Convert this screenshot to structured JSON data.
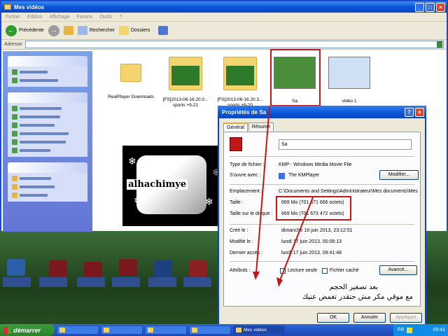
{
  "explorer": {
    "title": "Mes vidéos",
    "menu": [
      "Fichier",
      "Edition",
      "Affichage",
      "Favoris",
      "Outils",
      "?"
    ],
    "toolbar": {
      "back": "Précédente",
      "search": "Rechercher",
      "folders": "Dossiers"
    },
    "address_label": "Adresse",
    "files": [
      {
        "name": "RealPlayer Downloads",
        "kind": "folder"
      },
      {
        "name": "[FS]2013-06-16.20.0... sports +9-21",
        "kind": "folder-video"
      },
      {
        "name": "[FS]2013-06-16.20.3... sports +9-20",
        "kind": "folder-video"
      },
      {
        "name": "Sa",
        "kind": "video"
      },
      {
        "name": "vidéo 1",
        "kind": "video"
      }
    ],
    "logo_text": "alhachimye"
  },
  "dialog": {
    "title": "Propriétés de Sa",
    "tabs": [
      "Général",
      "Résumé"
    ],
    "name_value": "Sa",
    "rows": [
      {
        "label": "Type de fichier :",
        "value": "KMP - Windows Media Movie File"
      },
      {
        "label": "S'ouvre avec :",
        "value": "The KMPlayer"
      },
      {
        "label": "Emplacement :",
        "value": "C:\\Documents and Settings\\Administrateur\\Mes documents\\Mes vic"
      },
      {
        "label": "Taille :",
        "value": "669 Mo (701 671 666 octets)"
      },
      {
        "label": "Taille sur le disque :",
        "value": "669 Mo (701 673 472 octets)"
      },
      {
        "label": "Créé le :",
        "value": "dimanche 16 juin 2013, 23:12:51"
      },
      {
        "label": "Modifié le :",
        "value": "lundi 17 juin 2013, 00:06:13"
      },
      {
        "label": "Dernier accès :",
        "value": "lundi 17 juin 2013, 09:41:48"
      }
    ],
    "attributes_label": "Attributs :",
    "readonly_label": "Lecture seule",
    "hidden_label": "Fichier caché",
    "modify_button": "Modifier...",
    "advanced_button": "Avancé...",
    "ok_button": "OK",
    "cancel_button": "Annuler",
    "apply_button": "Appliquer"
  },
  "annotation": {
    "line1": "بعد تصغير الحجم",
    "line2": "مع موقي مكر مش حتقدر تغمض عنيك"
  },
  "taskbar": {
    "start_label": "démarrer",
    "active_task": "Mes vidéos",
    "lang": "FR",
    "time": "09:41"
  },
  "colors": {
    "annotation_red": "#c01818",
    "xp_blue": "#0b54d4",
    "start_green": "#2b822b"
  }
}
